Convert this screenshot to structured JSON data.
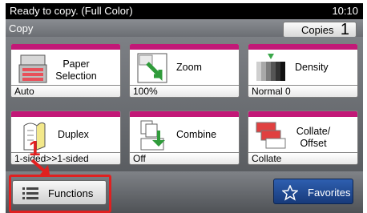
{
  "status": {
    "message": "Ready to copy. (Full Color)",
    "time": "10:10"
  },
  "title": {
    "screen": "Copy",
    "copies_label": "Copies",
    "copies_value": "1"
  },
  "tiles": [
    {
      "label": "Paper Selection",
      "value": "Auto",
      "icon": "paper-tray-icon"
    },
    {
      "label": "Zoom",
      "value": "100%",
      "icon": "zoom-icon"
    },
    {
      "label": "Density",
      "value": "Normal 0",
      "icon": "density-icon"
    },
    {
      "label": "Duplex",
      "value": "1-sided>>1-sided",
      "icon": "duplex-icon"
    },
    {
      "label": "Combine",
      "value": "Off",
      "icon": "combine-icon"
    },
    {
      "label": "Collate/ Offset",
      "value": "Collate",
      "icon": "collate-icon"
    }
  ],
  "bottom": {
    "functions_label": "Functions",
    "favorites_label": "Favorites"
  },
  "annotation": {
    "step": "1"
  },
  "colors": {
    "accent_band": "#c21877",
    "highlight": "#e02020",
    "favorites": "#1f4a96"
  }
}
